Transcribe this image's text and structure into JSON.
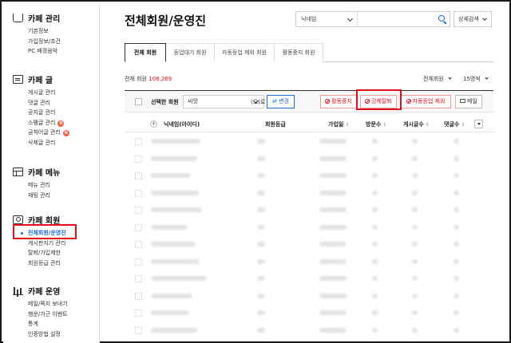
{
  "sidebar": {
    "sections": [
      {
        "title": "카페 관리",
        "items": [
          "기본정보",
          "가입정보/조건",
          "PC 배경음악"
        ]
      },
      {
        "title": "카페 글",
        "items": [
          "게시글 관리",
          "댓글 관리",
          "공지글 관리",
          "스팸글 관리",
          "금칙어글 관리",
          "삭제글 관리"
        ],
        "badge": "N"
      },
      {
        "title": "카페 메뉴",
        "items": [
          "메뉴 관리",
          "채팅 관리"
        ]
      },
      {
        "title": "카페 회원",
        "items": [
          "전체회원/운영진",
          "게시판지기 관리",
          "탈퇴/가입제한",
          "회원등급 관리"
        ]
      },
      {
        "title": "카페 운영",
        "items": [
          "메일/쪽지 보내기",
          "행운/가근 이벤트",
          "통계",
          "인증방법 설정"
        ]
      }
    ]
  },
  "header": {
    "title": "전체회원/운영진",
    "search_select": "닉네임",
    "search_placeholder": "",
    "detail_search": "상세검색"
  },
  "tabs": [
    "전체 회원",
    "등업대기 회원",
    "자동등업 제외 회원",
    "활동중지 회원"
  ],
  "summary": {
    "total_label": "전체 회원",
    "total_count": "108,269",
    "filter": "전체회원",
    "page_size": "15명씩"
  },
  "action_bar": {
    "selected_label": "선택한 회원",
    "grade_select": "씨앗",
    "suffix": "(으)로",
    "change": "변경",
    "suspend": "활동중지",
    "force_withdraw": "강제탈퇴",
    "exclude_auto": "자동등업 제외",
    "mail": "메일"
  },
  "table": {
    "columns": [
      "닉네임(아이디)",
      "회원등급",
      "가입일",
      "방문수",
      "게시글수",
      "댓글수"
    ]
  },
  "colors": {
    "accent": "#1e6bd6",
    "danger": "#e0101c",
    "highlight": "#e0101c"
  }
}
